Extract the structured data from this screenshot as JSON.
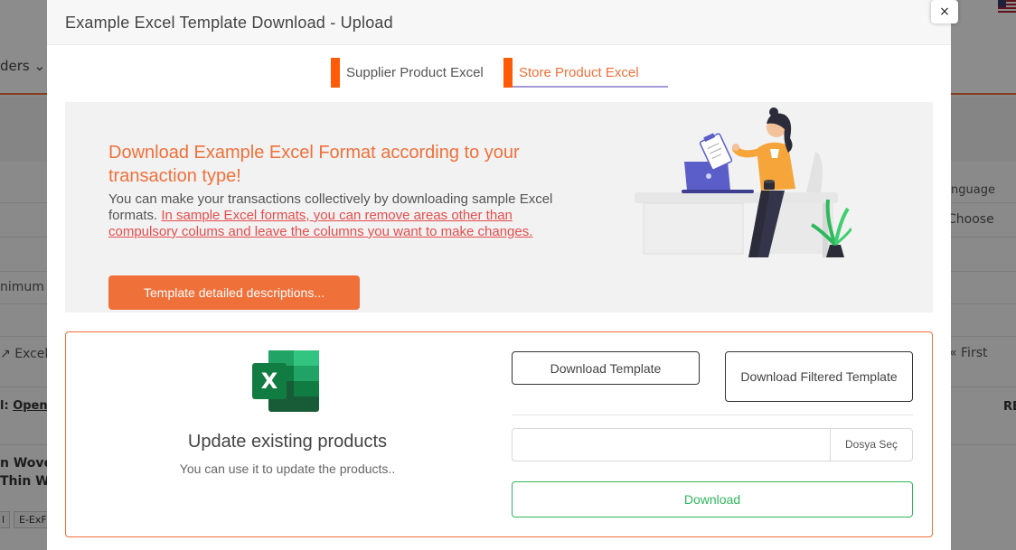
{
  "background": {
    "nav_orders": "ders",
    "language_label": "nguage",
    "language_value": "Choose",
    "minimum_placeholder": "nimum",
    "excel_link": "Excel",
    "first_label": "First",
    "label_prefix": "l:",
    "open_link": "Open",
    "col_re": "RE",
    "product_line_1": "n Wover",
    "product_line_2": "Thin Wa",
    "tag_1": "l",
    "tag_2": "E-ExF"
  },
  "modal": {
    "title": "Example Excel Template Download - Upload",
    "close_label": "×"
  },
  "tabs": [
    {
      "label": "Supplier Product Excel",
      "active": false
    },
    {
      "label": "Store Product Excel",
      "active": true
    }
  ],
  "info": {
    "title": "Download Example Excel Format according to your transaction type!",
    "description": "You can make your transactions collectively by downloading sample Excel formats.",
    "warning": "In sample Excel formats, you can remove areas other than compulsory colums and leave the columns you want to make changes.",
    "details_button": "Template detailed descriptions..."
  },
  "card": {
    "excel_letter": "X",
    "title": "Update existing products",
    "subtitle": "You can use it to update the products..",
    "download_template": "Download Template",
    "download_filtered": "Download Filtered Template",
    "file_input_value": "",
    "file_button": "Dosya Seç",
    "download_button": "Download"
  },
  "colors": {
    "accent": "#f0703a",
    "tab_bar": "#ff5b06",
    "warning": "#e74c4c",
    "success": "#2eb85c",
    "excel_green": "#107c41"
  }
}
